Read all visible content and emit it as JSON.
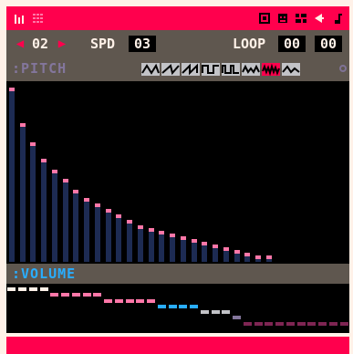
{
  "colors": {
    "accent": "#ff004d",
    "panel": "#5f574f",
    "background": "#000000",
    "pitch_bar": "#1d2b53",
    "pitch_dot": "#ff77a8",
    "volume_label": "#29adff",
    "pitch_label": "#83769c",
    "volume_low": "#1d2b53"
  },
  "topbar": {
    "left_icons": [
      "sfx-editor-icon",
      "pattern-editor-icon"
    ],
    "right_icons": [
      "code-icon",
      "sprite-icon",
      "map-icon",
      "sfx-icon",
      "music-icon"
    ]
  },
  "controls": {
    "sfx_index": "02",
    "speed_label": "SPD",
    "speed_value": "03",
    "loop_label": "LOOP",
    "loop_start": "00",
    "loop_end": "00"
  },
  "pitch": {
    "label": ":PITCH",
    "waveforms": [
      "triangle",
      "tilted-saw",
      "saw",
      "square",
      "pulse",
      "organ",
      "noise",
      "phaser"
    ],
    "selected_waveform_index": 6,
    "values": [
      62,
      49,
      42,
      36,
      32,
      29,
      25,
      22,
      20,
      18,
      16,
      14,
      12,
      11,
      10,
      9,
      8,
      7,
      6,
      5,
      4,
      3,
      2,
      1,
      1,
      0,
      0,
      0,
      0,
      0,
      0,
      0
    ],
    "max": 63
  },
  "volume": {
    "label": ":VOLUME",
    "values": [
      7,
      7,
      7,
      7,
      6,
      6,
      6,
      6,
      6,
      5,
      5,
      5,
      5,
      5,
      4,
      4,
      4,
      4,
      3,
      3,
      3,
      2,
      1,
      1,
      1,
      1,
      1,
      1,
      1,
      1,
      1,
      1
    ],
    "max": 7
  }
}
